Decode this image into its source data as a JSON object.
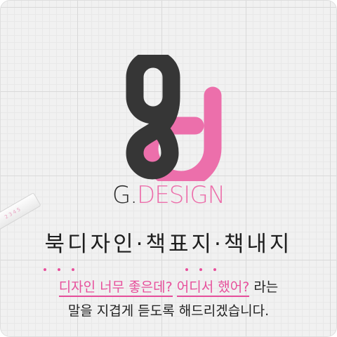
{
  "brand": {
    "initial": "G.",
    "rest": "DESIGN",
    "colors": {
      "dark": "#363636",
      "pink": "#ec6fab"
    }
  },
  "tagline": "북디자인·책표지·책내지",
  "description": {
    "quote_part1": "디자인 너무 좋은데?",
    "quote_part2": "어디서 했어?",
    "after_quote": "라는",
    "line2": "말을 지겹게 듣도록 해드리겠습니다."
  },
  "ruler_text": "2 3 4 5"
}
